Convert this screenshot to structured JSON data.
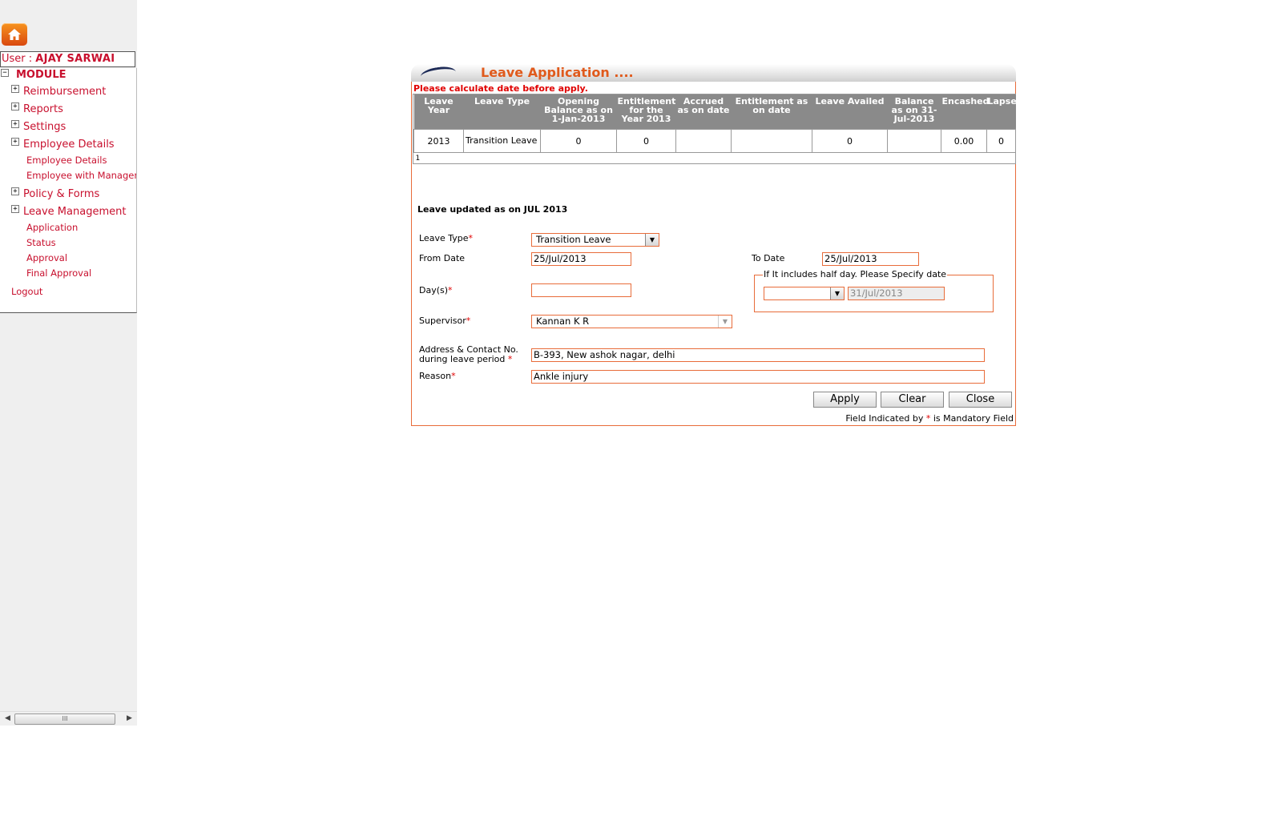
{
  "sidebar": {
    "user_label": "User :",
    "user_name": "AJAY SARWAI",
    "module_label": "MODULE",
    "items": [
      {
        "label": "Reimbursement"
      },
      {
        "label": "Reports"
      },
      {
        "label": "Settings"
      },
      {
        "label": "Employee Details",
        "children": [
          "Employee Details",
          "Employee with Manager"
        ]
      },
      {
        "label": "Policy & Forms"
      },
      {
        "label": "Leave Management",
        "children": [
          "Application",
          "Status",
          "Approval",
          "Final Approval"
        ]
      }
    ],
    "logout": "Logout",
    "scroll_thumb": "III"
  },
  "panel": {
    "title": "Leave Application ....",
    "warning": "Please calculate date before apply.",
    "grid": {
      "headers": [
        "Leave Year",
        "Leave Type",
        "Opening Balance as on 1-Jan-2013",
        "Entitlement for the Year 2013",
        "Accrued as on date",
        "Entitlement as on date",
        "Leave Availed",
        "Balance as on 31-Jul-2013",
        "Encashed",
        "Lapse"
      ],
      "rows": [
        [
          "2013",
          "Transition Leave",
          "0",
          "0",
          "",
          "",
          "0",
          "",
          "0.00",
          "0"
        ]
      ],
      "pager": "1"
    },
    "updated_label": "Leave updated as on JUL 2013",
    "form": {
      "leave_type_label": "Leave Type",
      "leave_type_value": "Transition Leave",
      "from_date_label": "From Date",
      "from_date_value": "25/Jul/2013",
      "to_date_label": "To Date",
      "to_date_value": "25/Jul/2013",
      "days_label": "Day(s)",
      "days_value": "",
      "halfday_legend": "If It includes half day. Please Specify date",
      "halfday_select_value": "",
      "halfday_date": "31/Jul/2013",
      "supervisor_label": "Supervisor",
      "supervisor_value": "Kannan K R",
      "address_label_line1": "Address & Contact No.",
      "address_label_line2": "during leave period",
      "address_value": "B-393, New ashok nagar, delhi",
      "reason_label": "Reason",
      "reason_value": "Ankle injury",
      "required_mark": "*"
    },
    "buttons": {
      "apply": "Apply",
      "clear": "Clear",
      "close": "Close"
    },
    "mandatory_note_prefix": "Field Indicated by",
    "mandatory_note_suffix": "is Mandatory Field"
  },
  "colors": {
    "accent": "#e86c3a",
    "title": "#e05a1c",
    "link": "#c8102e",
    "grid_header": "#8a8a8a"
  }
}
